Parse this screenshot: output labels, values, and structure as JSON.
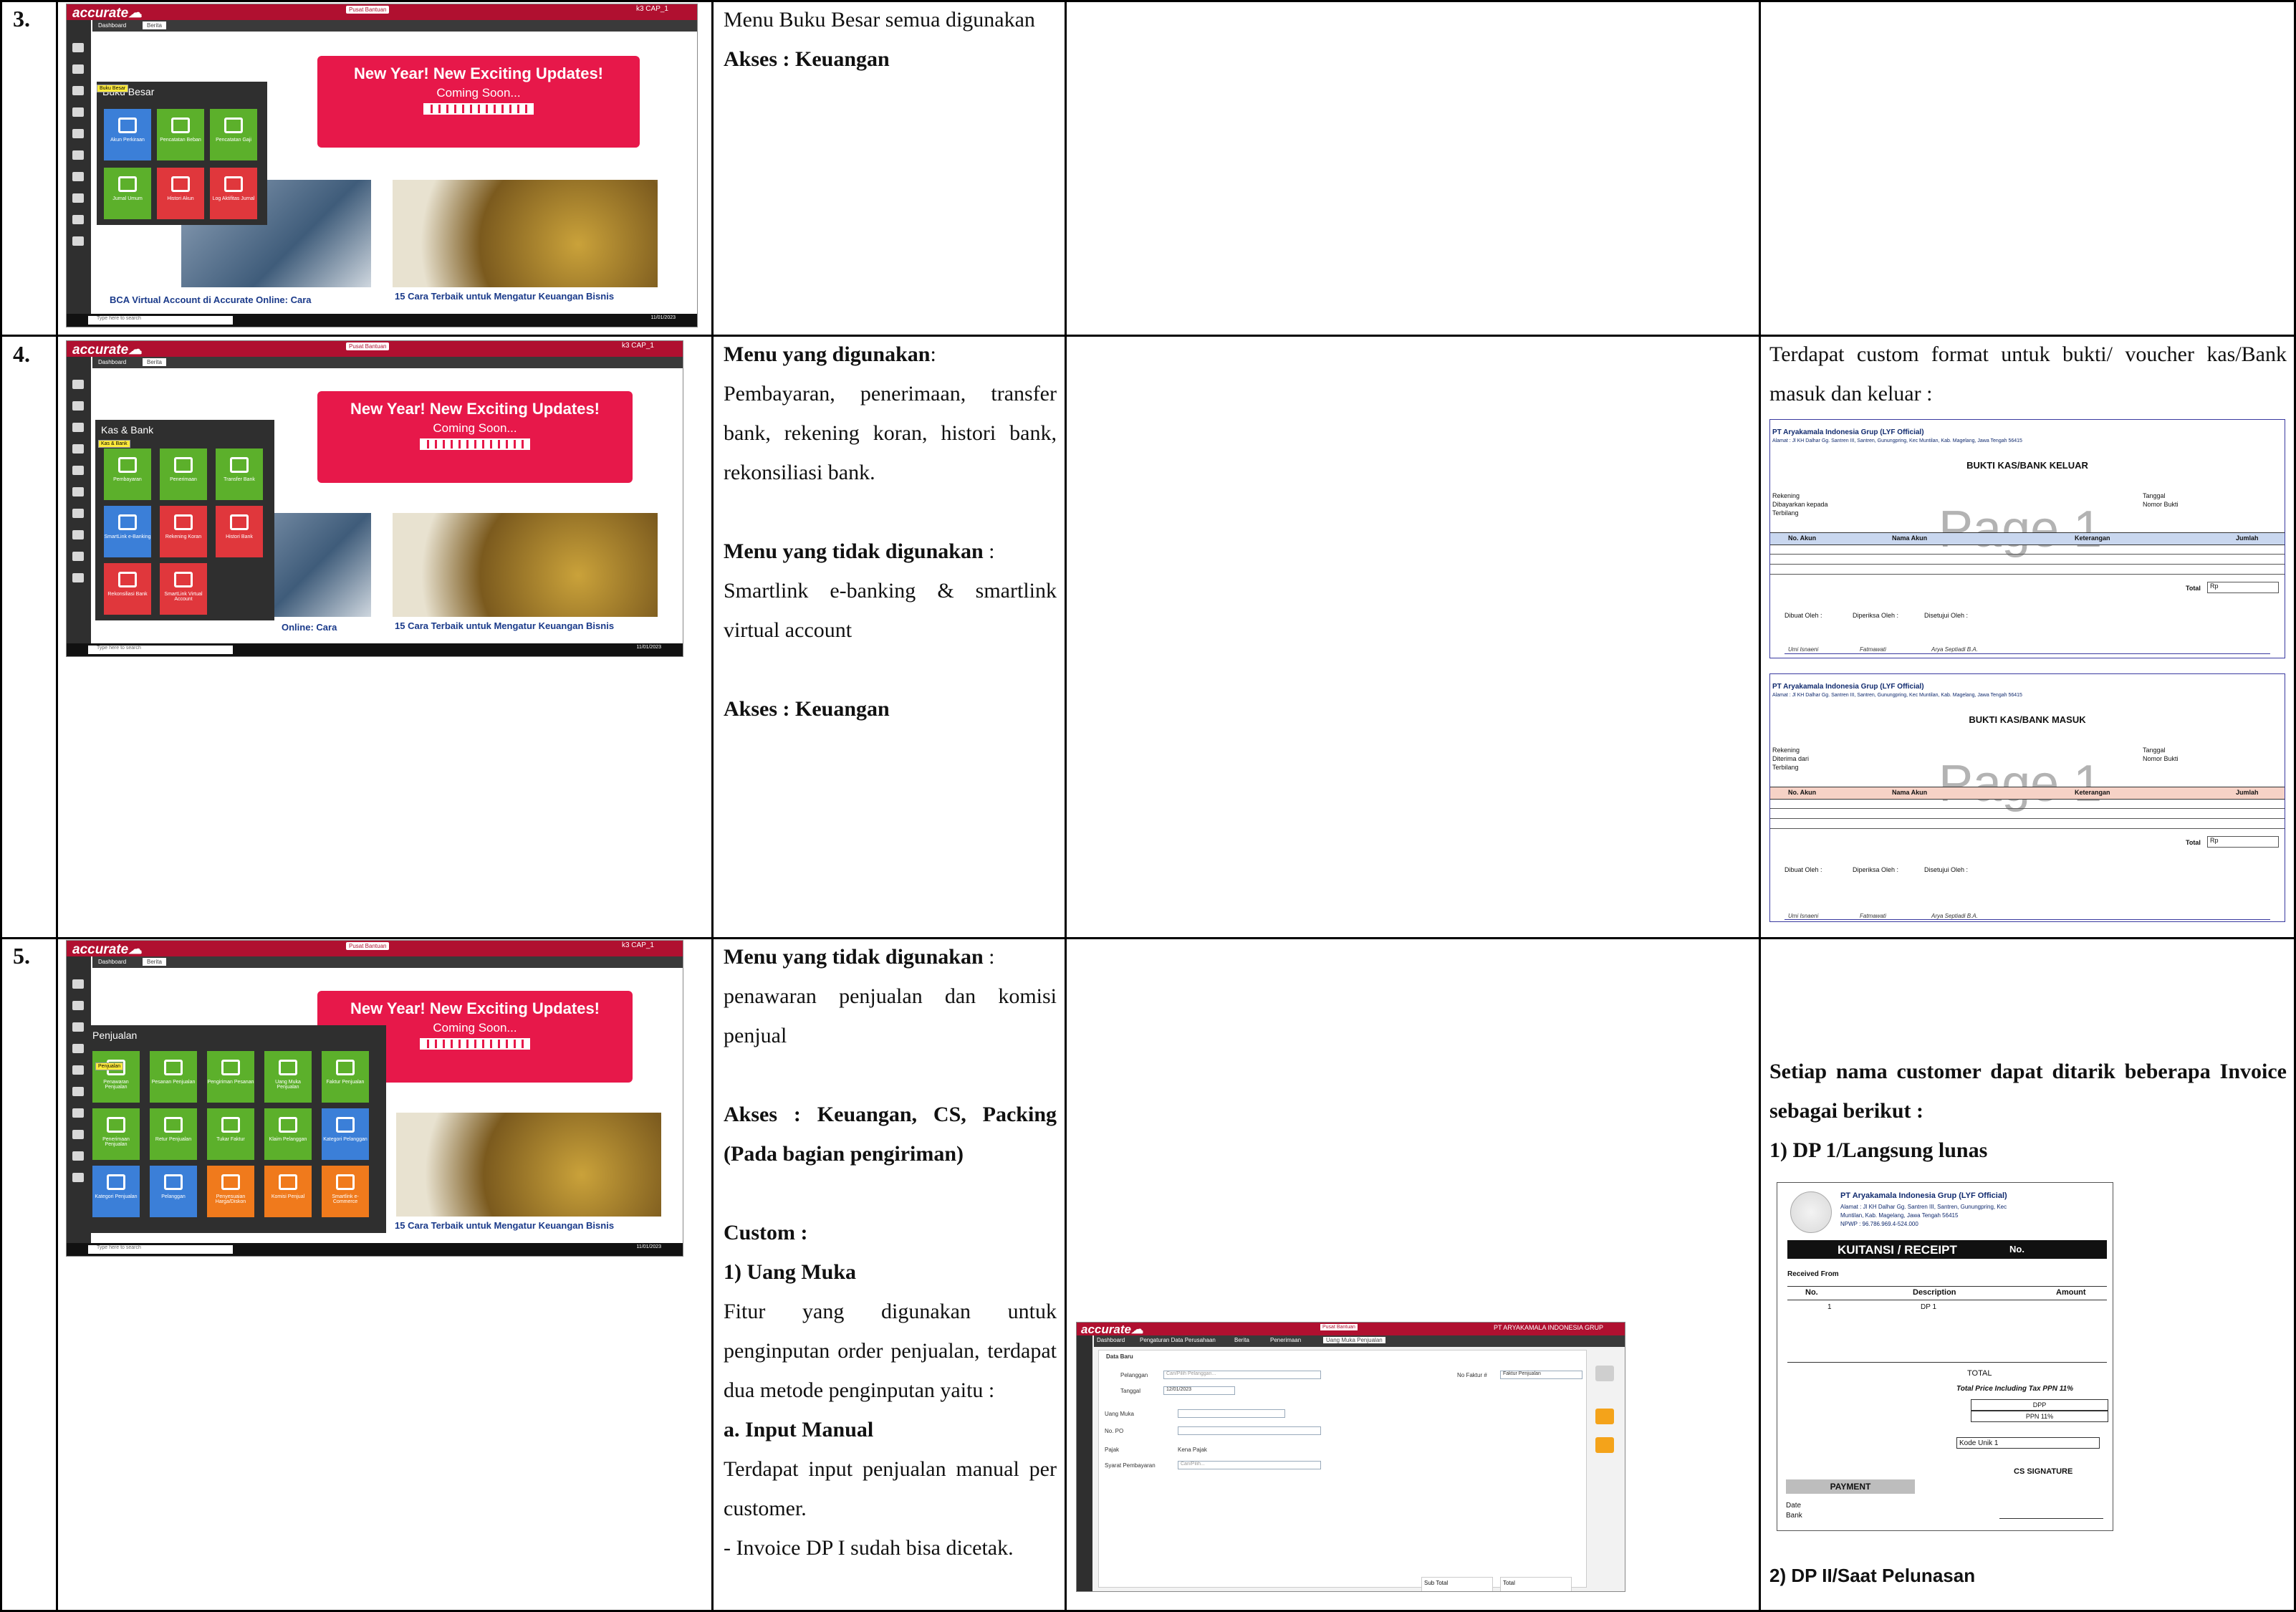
{
  "rows": [
    {
      "number": "3.",
      "col2": {
        "line1": "Menu Buku Besar semua digunakan",
        "line2": "Akses : Keuangan"
      },
      "screenshot": {
        "user": "k3 CAP_1",
        "tabs": [
          "Dashboard",
          "Berita"
        ],
        "menu_title": "Buku Besar",
        "tooltip": "Buku Besar",
        "tiles": [
          {
            "label": "Akun Perkiraan",
            "color": "bl"
          },
          {
            "label": "Pencatatan Beban",
            "color": "g"
          },
          {
            "label": "Pencatatan Gaji",
            "color": "g"
          },
          {
            "label": "Jurnal Umum",
            "color": "g"
          },
          {
            "label": "Histori Akun",
            "color": "r"
          },
          {
            "label": "Log Aktifitas Jurnal",
            "color": "r"
          }
        ],
        "caption1": "BCA Virtual Account di Accurate Online: Cara",
        "caption2": "15 Cara Terbaik untuk Mengatur Keuangan Bisnis"
      }
    },
    {
      "number": "4.",
      "col2": {
        "used_title": "Menu yang digunakan",
        "used_text": "Pembayaran, penerimaan, transfer bank, rekening koran, histori bank, rekonsiliasi bank.",
        "unused_title": "Menu yang tidak digunakan",
        "unused_text": "Smartlink e-banking & smartlink virtual account",
        "access": "Akses : Keuangan"
      },
      "screenshot": {
        "user": "k3 CAP_1",
        "tabs": [
          "Dashboard",
          "Berita"
        ],
        "menu_title": "Kas & Bank",
        "tooltip": "Kas & Bank",
        "tiles": [
          {
            "label": "Pembayaran",
            "color": "g"
          },
          {
            "label": "Penerimaan",
            "color": "g"
          },
          {
            "label": "Transfer Bank",
            "color": "g"
          },
          {
            "label": "SmartLink e-Banking",
            "color": "bl"
          },
          {
            "label": "Rekening Koran",
            "color": "r"
          },
          {
            "label": "Histori Bank",
            "color": "r"
          },
          {
            "label": "Rekonsiliasi Bank",
            "color": "r"
          },
          {
            "label": "SmartLink Virtual Account",
            "color": "r"
          }
        ],
        "caption1": "Online: Cara",
        "caption2": "15 Cara Terbaik untuk Mengatur Keuangan Bisnis"
      },
      "col4": {
        "text": "Terdapat custom format untuk bukti/ voucher kas/Bank masuk dan keluar :",
        "vouchers": [
          {
            "company": "PT Aryakamala Indonesia Grup (LYF Official)",
            "address": "Alamat : Jl KH Dalhar Gg. Santren III, Santren, Gunungpring, Kec Muntilan, Kab. Magelang, Jawa Tengah 56415",
            "title": "BUKTI KAS/BANK KELUAR",
            "fields_left": [
              "Rekening",
              "Dibayarkan kepada",
              "Terbilang"
            ],
            "fields_right": [
              "Tanggal",
              "Nomor Bukti"
            ],
            "watermark": "Page 1",
            "cols": [
              "No. Akun",
              "Nama Akun",
              "Keterangan",
              "Jumlah"
            ],
            "header_color": "#c9d7ef",
            "total": "Total",
            "currency": "Rp",
            "sign": [
              "Dibuat Oleh :",
              "Diperiksa Oleh :",
              "Disetujui Oleh :"
            ],
            "names": [
              "Umi Isnaeni",
              "Fatmawati",
              "Arya Septiadi B.A."
            ]
          },
          {
            "company": "PT Aryakamala Indonesia Grup (LYF Official)",
            "address": "Alamat : Jl KH Dalhar Gg. Santren III, Santren, Gunungpring, Kec Muntilan, Kab. Magelang, Jawa Tengah 56415",
            "title": "BUKTI KAS/BANK MASUK",
            "fields_left": [
              "Rekening",
              "Diterima dari",
              "Terbilang"
            ],
            "fields_right": [
              "Tanggal",
              "Nomor Bukti"
            ],
            "watermark": "Page 1",
            "cols": [
              "No. Akun",
              "Nama Akun",
              "Keterangan",
              "Jumlah"
            ],
            "header_color": "#f6d2c6",
            "total": "Total",
            "currency": "Rp",
            "sign": [
              "Dibuat Oleh :",
              "Diperiksa Oleh :",
              "Disetujui Oleh :"
            ],
            "names": [
              "Umi Isnaeni",
              "Fatmawati",
              "Arya Septiadi B.A."
            ]
          }
        ]
      }
    },
    {
      "number": "5.",
      "col2": {
        "unused_title": "Menu yang tidak digunakan",
        "unused_text": "penawaran penjualan dan komisi penjual",
        "access": "Akses : Keuangan, CS, Packing (Pada bagian pengiriman)",
        "custom": "Custom :",
        "item1": "1)   Uang Muka",
        "item1_text": "Fitur yang digunakan untuk penginputan order penjualan, terdapat dua metode penginputan yaitu :",
        "item_a": "a.   Input Manual",
        "item_a_text": "Terdapat input penjualan manual per customer.",
        "item_a_note": " - Invoice DP I sudah bisa dicetak."
      },
      "screenshot": {
        "user": "k3 CAP_1",
        "tabs": [
          "Dashboard",
          "Berita"
        ],
        "menu_title": "Penjualan",
        "tooltip": "Penjualan",
        "tiles": [
          {
            "label": "Penawaran Penjualan",
            "color": "g"
          },
          {
            "label": "Pesanan Penjualan",
            "color": "g"
          },
          {
            "label": "Pengiriman Pesanan",
            "color": "g"
          },
          {
            "label": "Uang Muka Penjualan",
            "color": "g"
          },
          {
            "label": "Faktur Penjualan",
            "color": "g"
          },
          {
            "label": "Penerimaan Penjualan",
            "color": "g"
          },
          {
            "label": "Retur Penjualan",
            "color": "g"
          },
          {
            "label": "Tukar Faktur",
            "color": "g"
          },
          {
            "label": "Klaim Pelanggan",
            "color": "g"
          },
          {
            "label": "Kategori Pelanggan",
            "color": "bl"
          },
          {
            "label": "Kategori Penjualan",
            "color": "bl"
          },
          {
            "label": "Pelanggan",
            "color": "bl"
          },
          {
            "label": "Penyesuaian Harga/Diskon",
            "color": "o"
          },
          {
            "label": "Komisi Penjual",
            "color": "o"
          },
          {
            "label": "Smartlink e-Commerce",
            "color": "o"
          }
        ],
        "caption1": "",
        "caption2": "15 Cara Terbaik untuk Mengatur Keuangan Bisnis"
      },
      "form": {
        "org": "PT ARYAKAMALA INDONESIA GRUP",
        "tabs": [
          "Dashboard",
          "Pengaturan Data Perusahaan",
          "Berita",
          "Penerimaan",
          "Uang Muka Penjualan"
        ],
        "data_baru": "Data Baru",
        "pelanggan": "Pelanggan",
        "pelanggan_ph": "Cari/Pilih Pelanggan...",
        "tanggal": "Tanggal",
        "tanggal_val": "12/01/2023",
        "no_faktur": "No Faktur #",
        "faktur_val": "Faktur Penjualan",
        "uang_muka": "Uang Muka",
        "no_po": "No. PO",
        "pajak": "Pajak",
        "kena_pajak": "Kena Pajak",
        "syarat": "Syarat Pembayaran",
        "syarat_ph": "Cari/Pilih...",
        "sub_total": "Sub Total",
        "total": "Total"
      },
      "col4": {
        "intro": "Setiap nama customer dapat ditarik beberapa Invoice sebagai berikut :",
        "dp1": "1)   DP 1/Langsung lunas",
        "dp2": "2)   DP II/Saat Pelunasan",
        "receipt": {
          "company": "PT Aryakamala Indonesia Grup (LYF Official)",
          "address": "Alamat : Jl KH Dalhar Gg. Santren III, Santren, Gunungpring, Kec Muntilan, Kab. Magelang, Jawa Tengah 56415",
          "npwp": "NPWP : 96.786.969.4-524.000",
          "title": "KUITANSI / RECEIPT",
          "no": "No.",
          "received": "Received From",
          "cols": [
            "No.",
            "Description",
            "Amount"
          ],
          "row_no": "1",
          "row_desc": "DP 1",
          "total": "TOTAL",
          "total_ppn": "Total Price Including Tax PPN 11%",
          "dpp": "DPP",
          "ppn": "PPN 11%",
          "kode": "Kode Unik 1",
          "cs": "CS SIGNATURE",
          "payment": "PAYMENT",
          "date": "Date",
          "bank": "Bank"
        }
      }
    }
  ]
}
